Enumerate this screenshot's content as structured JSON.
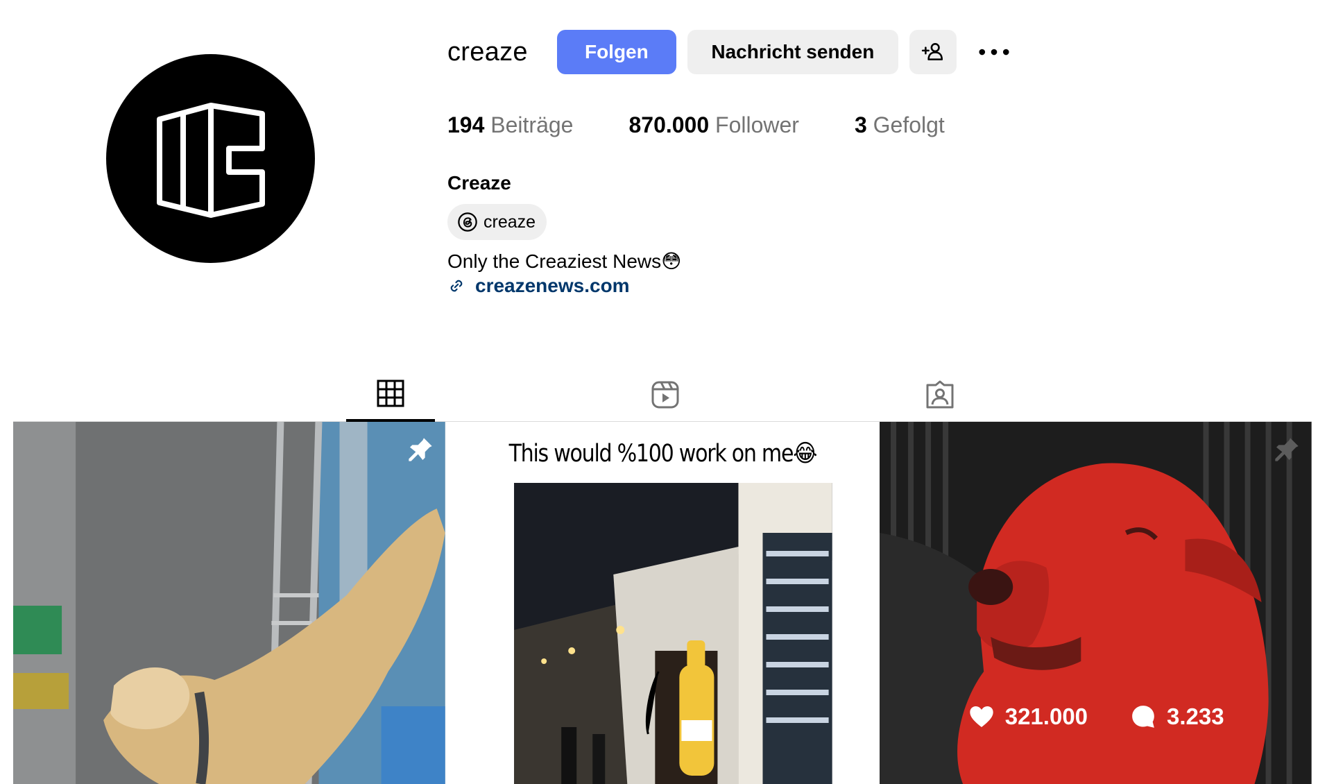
{
  "profile": {
    "username": "creaze",
    "full_name": "Creaze",
    "threads_handle": "creaze",
    "bio": "Only the Creaziest News😳",
    "link": "creazenews.com"
  },
  "actions": {
    "follow_label": "Folgen",
    "message_label": "Nachricht senden"
  },
  "stats": {
    "posts_count": "194",
    "posts_label": "Beiträge",
    "followers_count": "870.000",
    "followers_label": "Follower",
    "following_count": "3",
    "following_label": "Gefolgt"
  },
  "icons": {
    "add_person": "add-person-icon",
    "more": "more-icon",
    "threads": "threads-icon",
    "link": "link-icon",
    "tab_posts": "grid-icon",
    "tab_reels": "reels-icon",
    "tab_tagged": "tagged-icon",
    "pin": "pin-icon",
    "like": "heart-icon",
    "comment": "comment-icon"
  },
  "colors": {
    "follow_button": "#5b7cf7",
    "secondary_button": "#efefef",
    "link": "#00376b",
    "muted_text": "#737373"
  },
  "posts": [
    {
      "pinned": true,
      "description": "dog jumping"
    },
    {
      "caption": "This would %100 work on me😂"
    },
    {
      "pinned": true,
      "likes": "321.000",
      "comments": "3.233"
    }
  ]
}
